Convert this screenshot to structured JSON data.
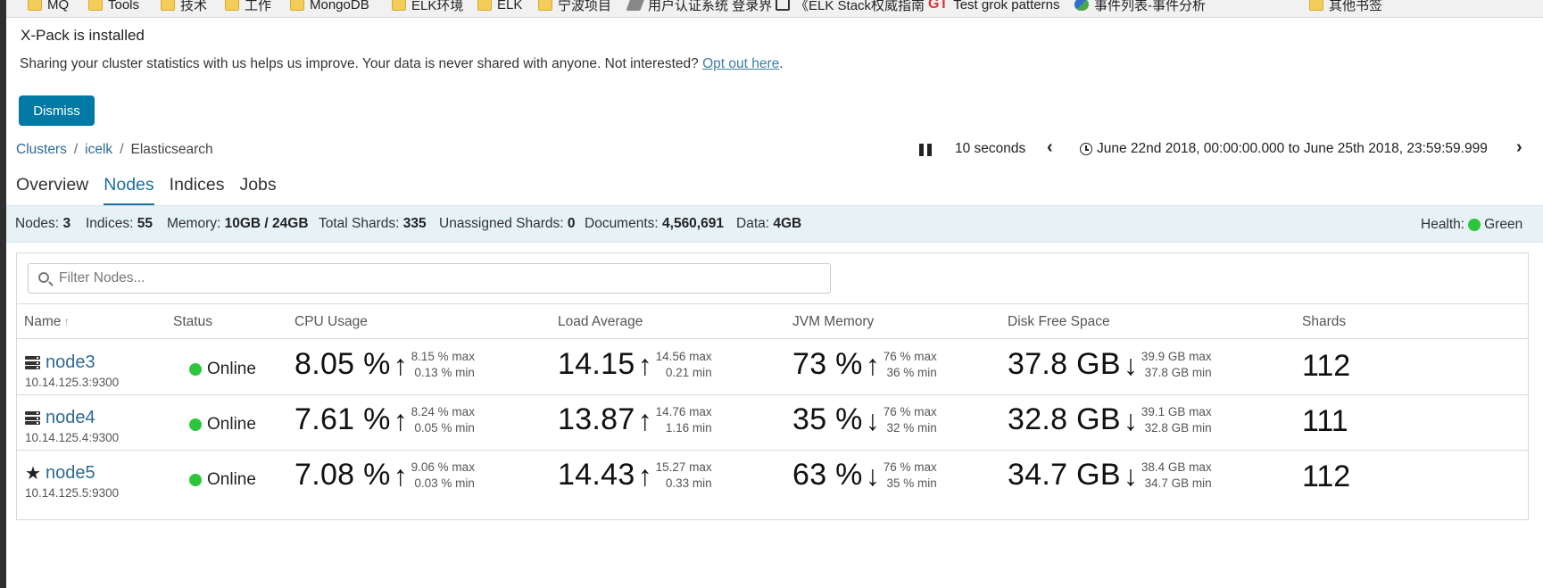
{
  "bookmarks": [
    {
      "label": "MQ",
      "icon": "folder"
    },
    {
      "label": "Tools",
      "icon": "folder"
    },
    {
      "label": "技术",
      "icon": "folder"
    },
    {
      "label": "工作",
      "icon": "folder"
    },
    {
      "label": "MongoDB",
      "icon": "folder"
    },
    {
      "label": "ELK环境",
      "icon": "folder"
    },
    {
      "label": "ELK",
      "icon": "folder"
    },
    {
      "label": "宁波项目",
      "icon": "folder"
    },
    {
      "label": "用户认证系统 登录界",
      "icon": "pen"
    },
    {
      "label": "《ELK Stack权威指南",
      "icon": "brackets"
    },
    {
      "label": "Test grok patterns",
      "icon": "gt"
    },
    {
      "label": "事件列表-事件分析",
      "icon": "wing"
    },
    {
      "label": "其他书签",
      "icon": "folder"
    }
  ],
  "banner": {
    "title": "X-Pack is installed",
    "text": "Sharing your cluster statistics with us helps us improve. Your data is never shared with anyone. Not interested?",
    "link": "Opt out here",
    "link_suffix": ".",
    "dismiss": "Dismiss"
  },
  "breadcrumb": {
    "items": [
      "Clusters",
      "icelk",
      "Elasticsearch"
    ],
    "separator": "/"
  },
  "time": {
    "interval": "10 seconds",
    "range": "June 22nd 2018, 00:00:00.000 to June 25th 2018, 23:59:59.999"
  },
  "tabs": [
    "Overview",
    "Nodes",
    "Indices",
    "Jobs"
  ],
  "active_tab": "Nodes",
  "summary": {
    "items": [
      {
        "label": "Nodes:",
        "value": "3"
      },
      {
        "label": "Indices:",
        "value": "55"
      },
      {
        "label": "Memory:",
        "value": "10GB / 24GB"
      },
      {
        "label": "Total Shards:",
        "value": "335"
      },
      {
        "label": "Unassigned Shards:",
        "value": "0"
      },
      {
        "label": "Documents:",
        "value": "4,560,691"
      },
      {
        "label": "Data:",
        "value": "4GB"
      }
    ],
    "health_label": "Health:",
    "health_value": "Green",
    "health_color": "#2ec53d"
  },
  "filter": {
    "placeholder": "Filter Nodes..."
  },
  "columns": [
    "Name",
    "Status",
    "CPU Usage",
    "Load Average",
    "JVM Memory",
    "Disk Free Space",
    "Shards"
  ],
  "nodes": [
    {
      "name": "node3",
      "address": "10.14.125.3:9300",
      "icon": "server-icon",
      "status": "Online",
      "cpu": {
        "value": "8.05 %",
        "trend": "up",
        "max": "8.15 % max",
        "min": "0.13 % min"
      },
      "load": {
        "value": "14.15",
        "trend": "up",
        "max": "14.56 max",
        "min": "0.21 min"
      },
      "jvm": {
        "value": "73 %",
        "trend": "up",
        "max": "76 % max",
        "min": "36 % min"
      },
      "disk": {
        "value": "37.8 GB",
        "trend": "down",
        "max": "39.9 GB max",
        "min": "37.8 GB min"
      },
      "shards": "112"
    },
    {
      "name": "node4",
      "address": "10.14.125.4:9300",
      "icon": "server-icon",
      "status": "Online",
      "cpu": {
        "value": "7.61 %",
        "trend": "up",
        "max": "8.24 % max",
        "min": "0.05 % min"
      },
      "load": {
        "value": "13.87",
        "trend": "up",
        "max": "14.76 max",
        "min": "1.16 min"
      },
      "jvm": {
        "value": "35 %",
        "trend": "down",
        "max": "76 % max",
        "min": "32 % min"
      },
      "disk": {
        "value": "32.8 GB",
        "trend": "down",
        "max": "39.1 GB max",
        "min": "32.8 GB min"
      },
      "shards": "111"
    },
    {
      "name": "node5",
      "address": "10.14.125.5:9300",
      "icon": "star-icon",
      "status": "Online",
      "cpu": {
        "value": "7.08 %",
        "trend": "up",
        "max": "9.06 % max",
        "min": "0.03 % min"
      },
      "load": {
        "value": "14.43",
        "trend": "up",
        "max": "15.27 max",
        "min": "0.33 min"
      },
      "jvm": {
        "value": "63 %",
        "trend": "down",
        "max": "76 % max",
        "min": "35 % min"
      },
      "disk": {
        "value": "34.7 GB",
        "trend": "down",
        "max": "38.4 GB max",
        "min": "34.7 GB min"
      },
      "shards": "112"
    }
  ],
  "colors": {
    "accent": "#0079a5",
    "link": "#2d6a93",
    "online": "#2ec53d",
    "summary_bg": "#e6f2f6"
  }
}
